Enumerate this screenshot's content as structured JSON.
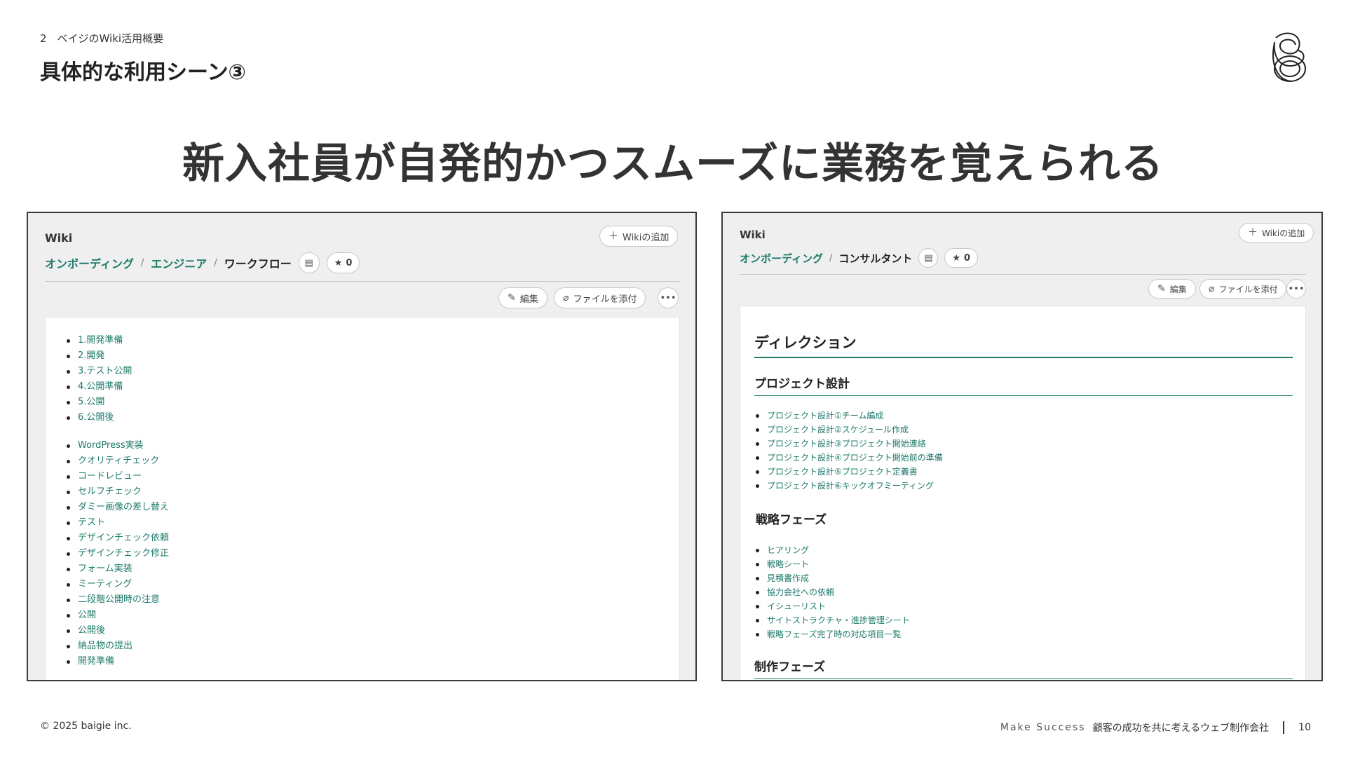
{
  "slide": {
    "section_label": "2　ベイジのWiki活用概要",
    "title": "具体的な利用シーン③",
    "headline": "新入社員が自発的かつスムーズに業務を覚えられる"
  },
  "left_screen": {
    "wiki_label": "Wiki",
    "add_wiki_label": "Wikiの追加",
    "breadcrumb": [
      "オンボーディング",
      "エンジニア",
      "ワークフロー"
    ],
    "separator": "/",
    "star_count": "0",
    "edit_label": "編集",
    "attach_label": "ファイルを添付",
    "list_a": [
      "1.開発準備",
      "2.開発",
      "3.テスト公開",
      "4.公開準備",
      "5.公開",
      "6.公開後"
    ],
    "list_b": [
      "WordPress実装",
      "クオリティチェック",
      "コードレビュー",
      "セルフチェック",
      "ダミー画像の差し替え",
      "テスト",
      "デザインチェック依頼",
      "デザインチェック修正",
      "フォーム実装",
      "ミーティング",
      "二段階公開時の注意",
      "公開",
      "公開後",
      "納品物の提出",
      "開発準備"
    ]
  },
  "right_screen": {
    "wiki_label": "Wiki",
    "add_wiki_label": "Wikiの追加",
    "breadcrumb": [
      "オンボーディング",
      "コンサルタント"
    ],
    "separator": "/",
    "star_count": "0",
    "edit_label": "編集",
    "attach_label": "ファイルを添付",
    "heading_main": "ディレクション",
    "heading_1": "プロジェクト設計",
    "list_1": [
      "プロジェクト設計①チーム編成",
      "プロジェクト設計②スケジュール作成",
      "プロジェクト設計③プロジェクト開始連絡",
      "プロジェクト設計④プロジェクト開始前の準備",
      "プロジェクト設計⑤プロジェクト定義書",
      "プロジェクト設計⑥キックオフミーティング"
    ],
    "heading_2": "戦略フェーズ",
    "list_2": [
      "ヒアリング",
      "戦略シート",
      "見積書作成",
      "協力会社への依頼",
      "イシューリスト",
      "サイトストラクチャ・進捗管理シート",
      "戦略フェーズ完了時の対応項目一覧"
    ],
    "heading_3": "制作フェーズ"
  },
  "footer": {
    "copyright": "© 2025 baigie inc.",
    "tagline": "Make Success",
    "company": "顧客の成功を共に考えるウェブ制作会社",
    "page_number": "10"
  },
  "colors": {
    "accent": "#1d7a6a",
    "frame": "#3a3a3a",
    "background": "#efefef"
  }
}
